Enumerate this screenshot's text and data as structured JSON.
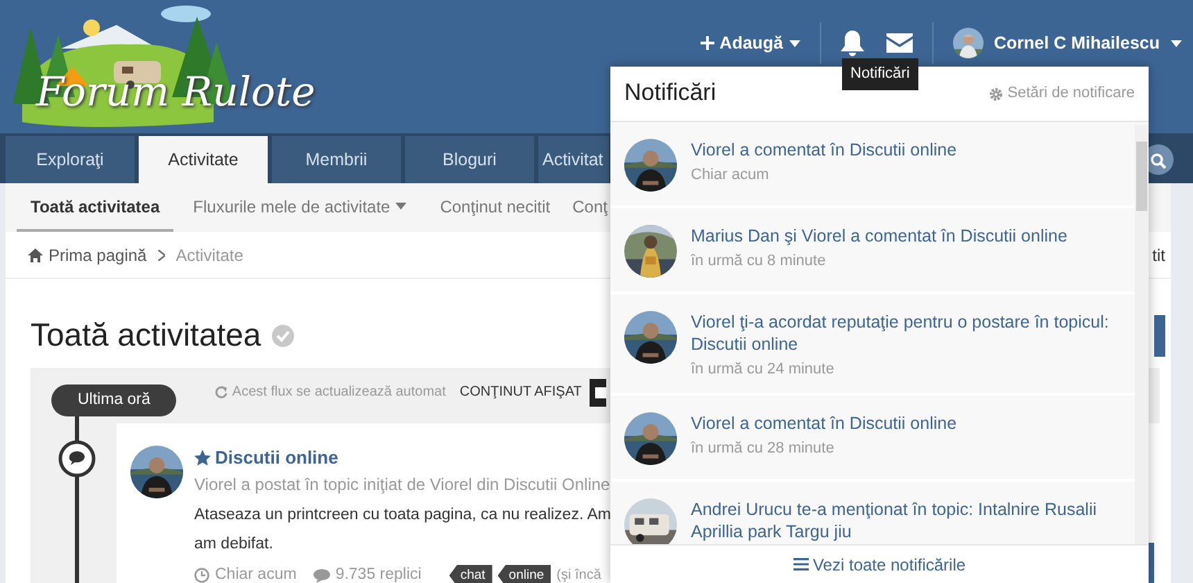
{
  "header": {
    "logo_text": "Forum Rulote",
    "add_button": "Adaugă",
    "user_name": "Cornel C Mihailescu",
    "tooltip": "Notificări"
  },
  "nav_tabs": [
    {
      "label": "Exploraţi",
      "selected": false
    },
    {
      "label": "Activitate",
      "selected": true
    },
    {
      "label": "Membrii",
      "selected": false
    },
    {
      "label": "Bloguri",
      "selected": false
    },
    {
      "label": "Activitat",
      "selected": false
    }
  ],
  "sub_nav": [
    {
      "label": "Toată activitatea",
      "selected": true,
      "dropdown": false
    },
    {
      "label": "Fluxurile mele de activitate",
      "selected": false,
      "dropdown": true
    },
    {
      "label": "Conţinut necitit",
      "selected": false,
      "dropdown": false
    },
    {
      "label": "Conţ",
      "selected": false,
      "dropdown": false
    }
  ],
  "breadcrumb": [
    "Prima pagină",
    "Activitate"
  ],
  "breadcrumb_right": "tit",
  "page_title": "Toată activitatea",
  "stream": {
    "timeline_label": "Ultima oră",
    "auto_update": "Acest flux se actualizează automat",
    "content_shown": "CONŢINUT AFIŞAT"
  },
  "post": {
    "title": "Discutii online",
    "subtitle": "Viorel a postat în topic iniţiat de Viorel din Discutii Online",
    "body_lines": [
      "Ataseaza un printcreen cu toata pagina, ca nu realizez. Am",
      "am debifat."
    ],
    "time": "Chiar acum",
    "replies": "9.735 replici",
    "tags": [
      "chat",
      "online"
    ],
    "more_tags": "(şi încă"
  },
  "notifications": {
    "title": "Notificări",
    "settings": "Setări de notificare",
    "items": [
      {
        "text": "Viorel a comentat în Discutii online",
        "time": "Chiar acum"
      },
      {
        "text": "Marius Dan şi Viorel a comentat în Discutii online",
        "time": "în urmă cu 8 minute"
      },
      {
        "text": "Viorel ţi-a acordat reputaţie pentru o postare în topicul: Discutii online",
        "time": "în urmă cu 24 minute"
      },
      {
        "text": "Viorel a comentat în Discutii online",
        "time": "în urmă cu 28 minute"
      },
      {
        "text": "Andrei Urucu te-a menţionat în topic: Intalnire Rusalii Aprillia park Targu jiu"
      }
    ],
    "footer": "Vezi toate notificările"
  }
}
